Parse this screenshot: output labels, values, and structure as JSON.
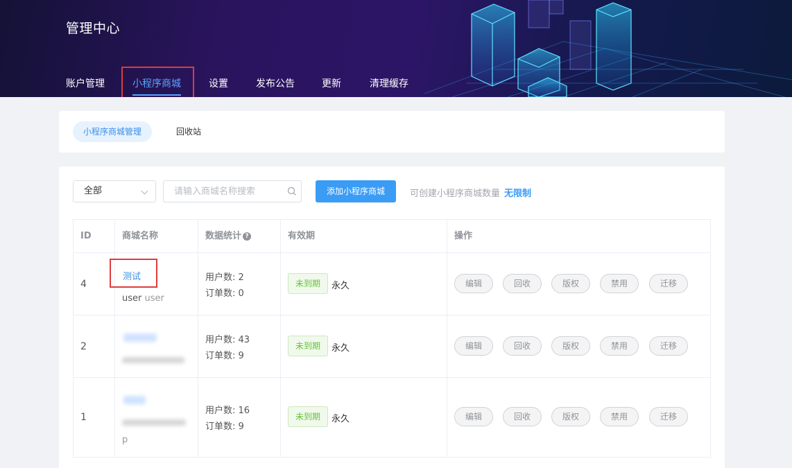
{
  "app": {
    "title": "管理中心"
  },
  "nav": {
    "items": [
      {
        "label": "账户管理"
      },
      {
        "label": "小程序商城",
        "active": true
      },
      {
        "label": "设置"
      },
      {
        "label": "发布公告"
      },
      {
        "label": "更新"
      },
      {
        "label": "清理缓存"
      }
    ]
  },
  "subtabs": [
    {
      "label": "小程序商城管理",
      "active": true
    },
    {
      "label": "回收站"
    }
  ],
  "toolbar": {
    "filter_value": "全部",
    "search_placeholder": "请输入商城名称搜索",
    "add_label": "添加小程序商城",
    "quota_label": "可创建小程序商城数量",
    "quota_value": "无限制"
  },
  "table": {
    "headers": {
      "id": "ID",
      "name": "商城名称",
      "stats": "数据统计",
      "validity": "有效期",
      "ops": "操作"
    },
    "rows": [
      {
        "id": "4",
        "name": "测试",
        "owner": "user",
        "owner_alt": "user",
        "users": "用户数: 2",
        "orders": "订单数: 0",
        "status": "未到期",
        "validity": "永久"
      },
      {
        "id": "2",
        "users": "用户数: 43",
        "orders": "订单数: 9",
        "status": "未到期",
        "validity": "永久"
      },
      {
        "id": "1",
        "owner_tail": "p",
        "users": "用户数: 16",
        "orders": "订单数: 9",
        "status": "未到期",
        "validity": "永久"
      }
    ],
    "ops": [
      "编辑",
      "回收",
      "版权",
      "禁用",
      "迁移"
    ]
  },
  "colors": {
    "accent": "#3a9cf5",
    "header_bg": "#2a145e",
    "highlight": "#e03b3b",
    "tag_green": "#67c23a"
  },
  "icons": {
    "filter": "chevron-down-icon",
    "search": "search-icon",
    "help": "question-circle-icon"
  }
}
